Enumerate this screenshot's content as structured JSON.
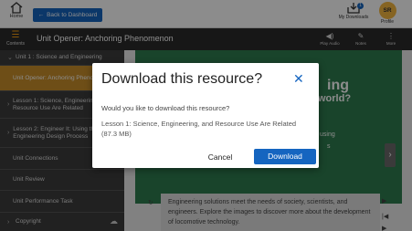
{
  "header": {
    "home_label": "Home",
    "back_label": "Back to Dashboard",
    "downloads_label": "My Downloads",
    "downloads_count": "1",
    "profile_initials": "SR",
    "profile_label": "Profile"
  },
  "unitbar": {
    "contents_label": "Contents",
    "title": "Unit Opener: Anchoring Phenomenon",
    "play_audio_label": "Play Audio",
    "notes_label": "Notes",
    "more_label": "More"
  },
  "sidebar": {
    "unit_heading": "Unit 1 : Science and Engineering",
    "items": [
      {
        "label": "Unit Opener: Anchoring Phenomenon"
      },
      {
        "label": "Lesson 1: Science, Engineering, and Resource Use Are Related"
      },
      {
        "label": "Lesson 2: Engineer It: Using the Engineering Design Process"
      },
      {
        "label": "Unit Connections"
      },
      {
        "label": "Unit Review"
      },
      {
        "label": "Unit Performance Task"
      }
    ],
    "copyright_label": "Copyright"
  },
  "content": {
    "green_fragment_1": "ing",
    "green_fragment_2": "world?",
    "green_fragment_3": "using",
    "green_fragment_4": "s",
    "reading_text": "Engineering solutions meet the needs of society, scientists, and engineers. Explore the images to discover more about the development of locomotive technology."
  },
  "modal": {
    "title": "Download this resource?",
    "question": "Would you like to download this resource?",
    "file_info": "Lesson 1: Science, Engineering, and Resource Use Are Related (87.3 MB)",
    "cancel_label": "Cancel",
    "download_label": "Download"
  },
  "colors": {
    "accent": "#1565c0",
    "active_item": "#c98f2a",
    "green_panel": "#2e7d4f",
    "avatar": "#f4b63f"
  }
}
